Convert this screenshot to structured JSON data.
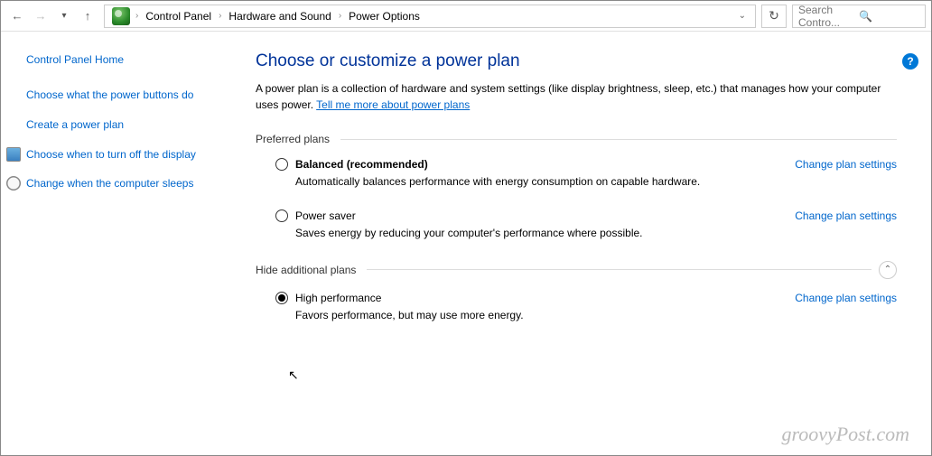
{
  "breadcrumb": [
    "Control Panel",
    "Hardware and Sound",
    "Power Options"
  ],
  "search_placeholder": "Search Contro...",
  "sidebar": {
    "home": "Control Panel Home",
    "links": [
      {
        "text": "Choose what the power buttons do",
        "icon": null
      },
      {
        "text": "Create a power plan",
        "icon": null
      },
      {
        "text": "Choose when to turn off the display",
        "icon": "mon"
      },
      {
        "text": "Change when the computer sleeps",
        "icon": "clock"
      }
    ]
  },
  "title": "Choose or customize a power plan",
  "description_pre": "A power plan is a collection of hardware and system settings (like display brightness, sleep, etc.) that manages how your computer uses power. ",
  "description_link": "Tell me more about power plans",
  "preferred_label": "Preferred plans",
  "additional_label": "Hide additional plans",
  "change_label": "Change plan settings",
  "plans_preferred": [
    {
      "name": "Balanced (recommended)",
      "bold": true,
      "selected": false,
      "desc": "Automatically balances performance with energy consumption on capable hardware."
    },
    {
      "name": "Power saver",
      "bold": false,
      "selected": false,
      "desc": "Saves energy by reducing your computer's performance where possible."
    }
  ],
  "plans_additional": [
    {
      "name": "High performance",
      "bold": false,
      "selected": true,
      "desc": "Favors performance, but may use more energy."
    }
  ],
  "watermark": "groovyPost.com"
}
